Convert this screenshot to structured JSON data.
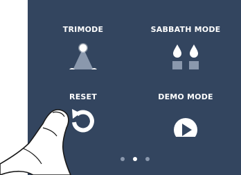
{
  "menu": {
    "items": [
      {
        "label": "TRIMODE",
        "icon": "trimode-triangle-icon"
      },
      {
        "label": "SABBATH MODE",
        "icon": "sabbath-candles-icon"
      },
      {
        "label": "RESET",
        "icon": "reset-arrow-icon"
      },
      {
        "label": "DEMO MODE",
        "icon": "play-icon"
      }
    ]
  },
  "pager": {
    "page_count": 3,
    "current_page": 2
  },
  "colors": {
    "panel_background": "#33455f",
    "text": "#ffffff",
    "icon_gray": "#8a98ad",
    "dot_inactive": "#8a98ad",
    "dot_active": "#ffffff"
  }
}
